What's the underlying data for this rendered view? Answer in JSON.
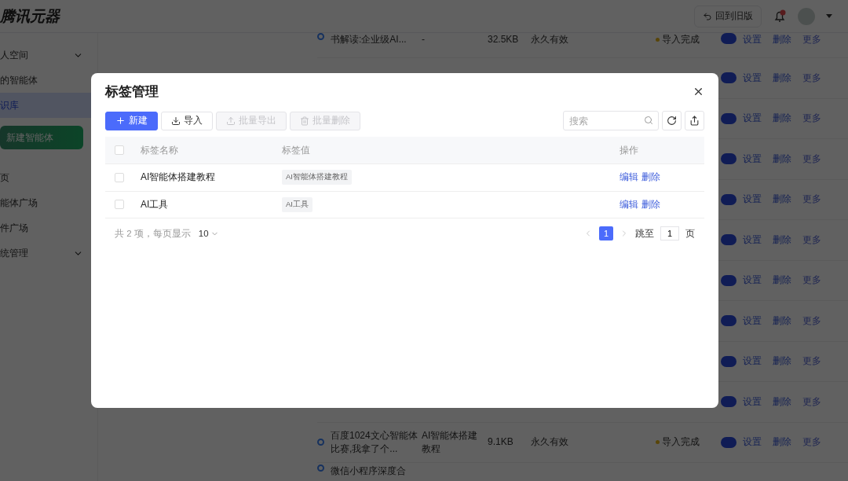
{
  "header": {
    "logo": "腾讯元器",
    "back_button": "回到旧版"
  },
  "sidebar": {
    "items": [
      {
        "label": "人空间",
        "kind": "group",
        "selected": false
      },
      {
        "label": "的智能体",
        "kind": "item",
        "selected": false
      },
      {
        "label": "识库",
        "kind": "item",
        "selected": true
      },
      {
        "label": "新建智能体",
        "kind": "button"
      },
      {
        "label": "页",
        "kind": "item",
        "selected": false
      },
      {
        "label": "能体广场",
        "kind": "item",
        "selected": false
      },
      {
        "label": "件广场",
        "kind": "item",
        "selected": false
      },
      {
        "label": "统管理",
        "kind": "group",
        "selected": false
      }
    ]
  },
  "documents": {
    "rows": [
      {
        "kind": "partial",
        "title": "书解读:企业级AI...",
        "tag": "-",
        "size": "32.5KB",
        "validity": "永久有效",
        "status": "导入完成",
        "enabled": true,
        "actions": [
          "设置",
          "删除",
          "更多"
        ]
      },
      {
        "kind": "full",
        "enabled": true,
        "actions": [
          "设置",
          "删除",
          "更多"
        ]
      },
      {
        "kind": "full",
        "enabled": true,
        "actions": [
          "设置",
          "删除",
          "更多"
        ]
      },
      {
        "kind": "full",
        "enabled": true,
        "actions": [
          "设置",
          "删除",
          "更多"
        ]
      },
      {
        "kind": "full",
        "enabled": true,
        "actions": [
          "设置",
          "删除",
          "更多"
        ]
      },
      {
        "kind": "full",
        "enabled": true,
        "actions": [
          "设置",
          "删除",
          "更多"
        ]
      },
      {
        "kind": "full",
        "enabled": true,
        "actions": [
          "设置",
          "删除",
          "更多"
        ]
      },
      {
        "kind": "full",
        "enabled": true,
        "actions": [
          "设置",
          "删除",
          "更多"
        ]
      },
      {
        "kind": "full",
        "enabled": true,
        "actions": [
          "设置",
          "删除",
          "更多"
        ]
      },
      {
        "kind": "full",
        "enabled": true,
        "actions": [
          "设置",
          "删除",
          "更多"
        ]
      },
      {
        "kind": "full",
        "title": "百度1024文心智能体比赛,我拿了个...",
        "tag": "AI智能体搭建教程",
        "size": "9.1KB",
        "validity": "永久有效",
        "status": "导入完成",
        "enabled": true,
        "actions": [
          "设置",
          "删除",
          "更多"
        ]
      },
      {
        "kind": "cut",
        "title": "微信小程序深度合"
      }
    ]
  },
  "modal": {
    "title": "标签管理",
    "toolbar": [
      {
        "label": "新建",
        "kind": "new",
        "disabled": false
      },
      {
        "label": "导入",
        "kind": "import",
        "disabled": false
      },
      {
        "label": "批量导出",
        "kind": "export",
        "disabled": true
      },
      {
        "label": "批量删除",
        "kind": "delete",
        "disabled": true
      }
    ],
    "search": {
      "placeholder": "搜索"
    },
    "select_all": {
      "checked": false
    },
    "columns": [
      "标签名称",
      "标签值",
      "操作"
    ],
    "rows": [
      {
        "name": "AI智能体搭建教程",
        "value": "AI智能体搭建教程",
        "selected": false,
        "actions": [
          "编辑",
          "删除"
        ]
      },
      {
        "name": "AI工具",
        "value": "AI工具",
        "selected": false,
        "actions": [
          "编辑",
          "删除"
        ]
      }
    ],
    "footer": {
      "total": "共 2 项，每页显示",
      "page_size": "10",
      "pages": [
        {
          "label": "1",
          "selected": true
        }
      ],
      "jump_label": "跳至",
      "jump_value": "1",
      "page_unit": "页"
    }
  }
}
